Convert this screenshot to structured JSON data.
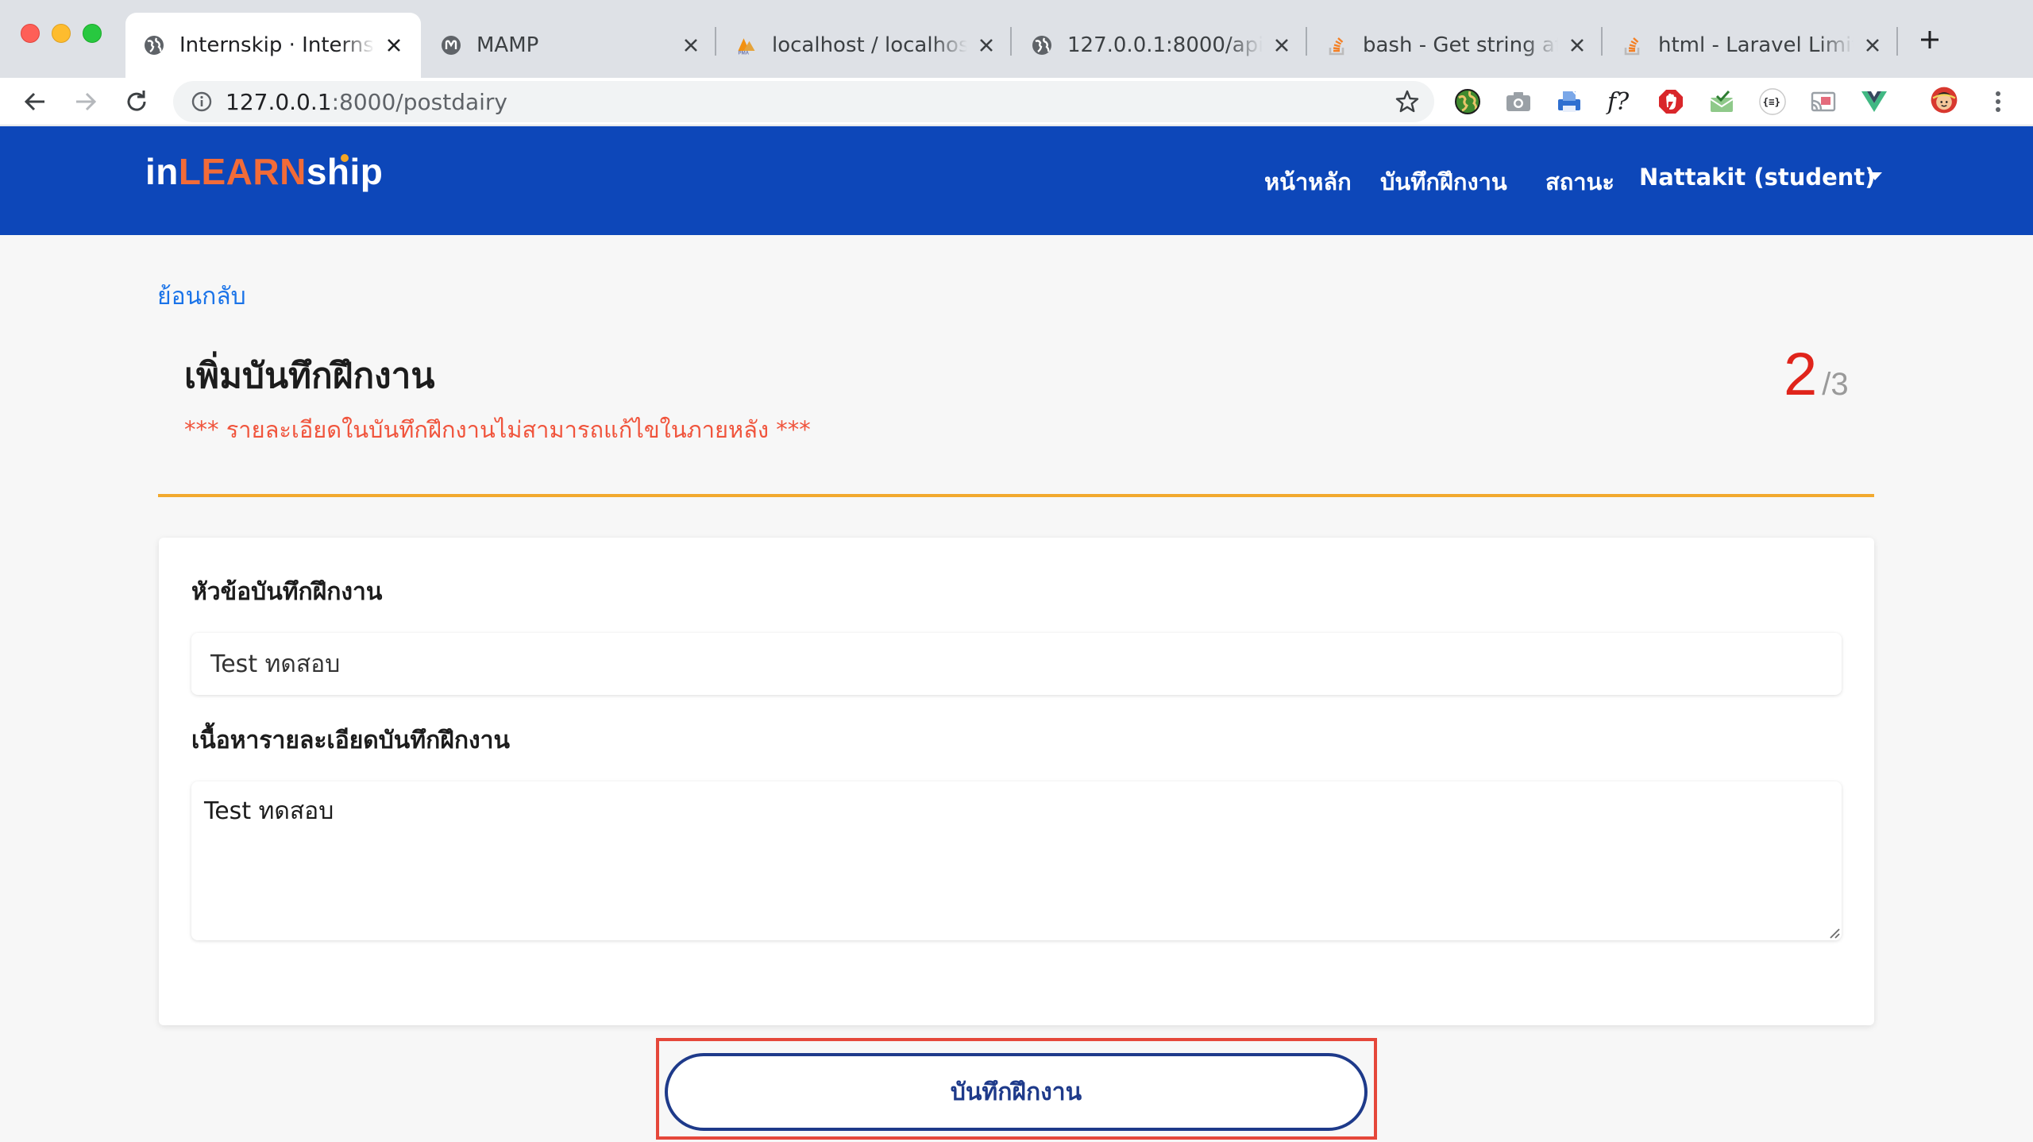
{
  "browser": {
    "tabs": [
      {
        "title": "Internskip · Internskip",
        "favicon": "globe-icon",
        "active": true
      },
      {
        "title": "MAMP",
        "favicon": "mamp-icon",
        "active": false
      },
      {
        "title": "localhost / localhost / s",
        "favicon": "phpmyadmin-icon",
        "active": false
      },
      {
        "title": "127.0.0.1:8000/api/inte",
        "favicon": "globe-icon",
        "active": false
      },
      {
        "title": "bash - Get string after",
        "favicon": "stackoverflow-icon",
        "active": false
      },
      {
        "title": "html - Laravel Limit Ch",
        "favicon": "stackoverflow-icon",
        "active": false
      }
    ],
    "url_host": "127.0.0.1",
    "url_rest": ":8000/postdairy"
  },
  "site": {
    "logo": {
      "part1": "in",
      "part2": "LEARN",
      "part3": "ship"
    },
    "nav": {
      "home": "หน้าหลัก",
      "journal": "บันทึกฝึกงาน",
      "status": "สถานะ",
      "user": "Nattakit (student)"
    }
  },
  "page": {
    "back": "ย้อนกลับ",
    "title": "เพิ่มบันทึกฝึกงาน",
    "warning": "*** รายละเอียดในบันทึกฝึกงานไม่สามารถแก้ไขในภายหลัง ***",
    "counter_current": "2",
    "counter_total": "/3",
    "form": {
      "topic_label": "หัวข้อบันทึกฝึกงาน",
      "topic_value": "Test ทดสอบ",
      "detail_label": "เนื้อหารายละเอียดบันทึกฝึกงาน",
      "detail_value": "Test ทดสอบ"
    },
    "submit_label": "บันทึกฝึกงาน"
  },
  "colors": {
    "header": "#0d47b9",
    "logo_accent": "#f26b38",
    "warning": "#f0543c",
    "counter": "#e0241b",
    "divider": "#f2a92e",
    "button": "#1e3a8a",
    "highlight": "#e5473a"
  }
}
